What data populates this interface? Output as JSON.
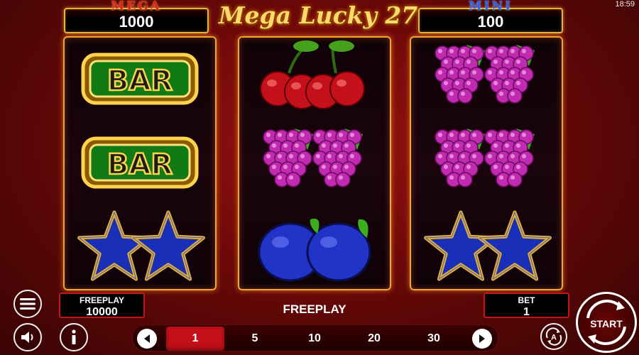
{
  "status_bar": {
    "time": "18:59"
  },
  "game": {
    "logo": "Mega Lucky 27"
  },
  "jackpots": {
    "mega": {
      "title": "MEGA",
      "value": "1000"
    },
    "mini": {
      "title": "MINI",
      "value": "100"
    }
  },
  "reels": [
    [
      "bar",
      "bar",
      "stars"
    ],
    [
      "cherries",
      "grapes",
      "plums"
    ],
    [
      "grapes",
      "grapes",
      "stars"
    ]
  ],
  "panel": {
    "freeplay_label": "FREEPLAY",
    "freeplay_value": "10000",
    "status_text": "FREEPLAY",
    "bet_label": "BET",
    "bet_value": "1"
  },
  "bet_options": [
    "1",
    "5",
    "10",
    "20",
    "30"
  ],
  "selected_bet": "1",
  "controls": {
    "start_label": "START",
    "icons": [
      "menu-icon",
      "speaker-icon",
      "info-icon",
      "autoplay-icon",
      "prev-arrow-icon",
      "next-arrow-icon"
    ]
  },
  "colors": {
    "background": "#7a0a0a",
    "frame_gold": "#f2a331",
    "accent_red": "#c20f18",
    "mega_red": "#e0201a",
    "mini_blue": "#2c62e6"
  }
}
